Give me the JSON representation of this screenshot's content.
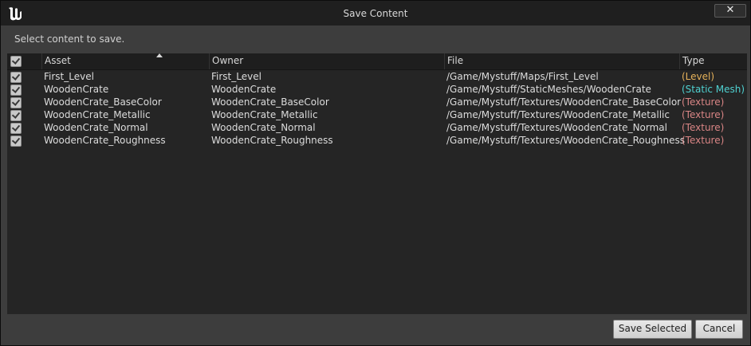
{
  "window": {
    "title": "Save Content",
    "close_label": "✕"
  },
  "prompt": "Select content to save.",
  "columns": {
    "asset": "Asset",
    "owner": "Owner",
    "file": "File",
    "type": "Type"
  },
  "rows": [
    {
      "asset": "First_Level",
      "owner": "First_Level",
      "file": "/Game/Mystuff/Maps/First_Level",
      "type": "(Level)",
      "type_color": "#e6b25a",
      "checked": true
    },
    {
      "asset": "WoodenCrate",
      "owner": "WoodenCrate",
      "file": "/Game/Mystuff/StaticMeshes/WoodenCrate",
      "type": "(Static Mesh)",
      "type_color": "#4fd1d1",
      "checked": true
    },
    {
      "asset": "WoodenCrate_BaseColor",
      "owner": "WoodenCrate_BaseColor",
      "file": "/Game/Mystuff/Textures/WoodenCrate_BaseColor",
      "type": "(Texture)",
      "type_color": "#d98585",
      "checked": true
    },
    {
      "asset": "WoodenCrate_Metallic",
      "owner": "WoodenCrate_Metallic",
      "file": "/Game/Mystuff/Textures/WoodenCrate_Metallic",
      "type": "(Texture)",
      "type_color": "#d98585",
      "checked": true
    },
    {
      "asset": "WoodenCrate_Normal",
      "owner": "WoodenCrate_Normal",
      "file": "/Game/Mystuff/Textures/WoodenCrate_Normal",
      "type": "(Texture)",
      "type_color": "#d98585",
      "checked": true
    },
    {
      "asset": "WoodenCrate_Roughness",
      "owner": "WoodenCrate_Roughness",
      "file": "/Game/Mystuff/Textures/WoodenCrate_Roughness",
      "type": "(Texture)",
      "type_color": "#d98585",
      "checked": true
    }
  ],
  "buttons": {
    "save_selected": "Save Selected",
    "cancel": "Cancel"
  }
}
